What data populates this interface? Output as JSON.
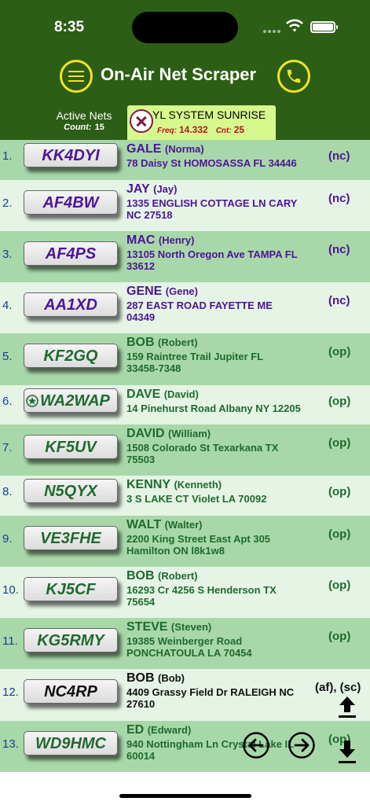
{
  "status_bar": {
    "time": "8:35"
  },
  "header": {
    "title": "On-Air Net Scraper",
    "active_nets_label": "Active Nets",
    "count_label": "Count:",
    "count_value": "15"
  },
  "net_tab": {
    "name": "YL SYSTEM SUNRISE",
    "freq_label": "Freq:",
    "freq_value": "14.332",
    "cnt_label": "Cnt:",
    "cnt_value": "25"
  },
  "colors": {
    "header_green": "#2d5e16",
    "accent_yellow": "#f2e225",
    "row_dark": "#a8d8a9",
    "row_light": "#e5f4e5",
    "nc_purple": "#4d1497",
    "op_green": "#1f6a2f"
  },
  "icons": {
    "menu": "hamburger-icon",
    "phone": "phone-icon",
    "close": "close-icon",
    "prev": "arrow-left-circle-icon",
    "next": "arrow-right-circle-icon",
    "upload": "upload-icon",
    "download": "download-icon",
    "badge": "star-badge-icon"
  },
  "stations": [
    {
      "num": "1.",
      "call": "KK4DYI",
      "name": "GALE",
      "nick": "(Norma)",
      "addr1": "78 Daisy St HOMOSASSA FL 34446",
      "addr2": "",
      "status": "(nc)",
      "kind": "nc"
    },
    {
      "num": "2.",
      "call": "AF4BW",
      "name": "JAY",
      "nick": "(Jay)",
      "addr1": "1335 ENGLISH COTTAGE LN CARY",
      "addr2": "NC 27518",
      "status": "(nc)",
      "kind": "nc"
    },
    {
      "num": "3.",
      "call": "AF4PS",
      "name": "MAC",
      "nick": "(Henry)",
      "addr1": "13105 North Oregon Ave TAMPA FL",
      "addr2": "33612",
      "status": "(nc)",
      "kind": "nc"
    },
    {
      "num": "4.",
      "call": "AA1XD",
      "name": "GENE",
      "nick": "(Gene)",
      "addr1": "287 EAST ROAD FAYETTE ME",
      "addr2": "04349",
      "status": "(nc)",
      "kind": "nc"
    },
    {
      "num": "5.",
      "call": "KF2GQ",
      "name": "BOB",
      "nick": "(Robert)",
      "addr1": "159 Raintree Trail Jupiter FL",
      "addr2": "33458-7348",
      "status": "(op)",
      "kind": "op"
    },
    {
      "num": "6.",
      "call": "WA2WAP",
      "name": "DAVE",
      "nick": "(David)",
      "addr1": "14 Pinehurst Road Albany NY 12205",
      "addr2": "",
      "status": "(op)",
      "kind": "op"
    },
    {
      "num": "7.",
      "call": "KF5UV",
      "name": "DAVID",
      "nick": "(William)",
      "addr1": "1508 Colorado St Texarkana TX",
      "addr2": "75503",
      "status": "(op)",
      "kind": "op"
    },
    {
      "num": "8.",
      "call": "N5QYX",
      "name": "KENNY",
      "nick": "(Kenneth)",
      "addr1": "3 S LAKE CT Violet LA 70092",
      "addr2": "",
      "status": "(op)",
      "kind": "op"
    },
    {
      "num": "9.",
      "call": "VE3FHE",
      "name": "WALT",
      "nick": "(Walter)",
      "addr1": "2200 King Street East  Apt 305",
      "addr2": "Hamilton ON l8k1w8",
      "status": "(op)",
      "kind": "op"
    },
    {
      "num": "10.",
      "call": "KJ5CF",
      "name": "BOB",
      "nick": "(Robert)",
      "addr1": "16293 Cr 4256 S Henderson TX",
      "addr2": "75654",
      "status": "(op)",
      "kind": "op"
    },
    {
      "num": "11.",
      "call": "KG5RMY",
      "name": "STEVE",
      "nick": "(Steven)",
      "addr1": "19385 Weinberger Road",
      "addr2": "PONCHATOULA LA 70454",
      "status": "(op)",
      "kind": "op"
    },
    {
      "num": "12.",
      "call": "NC4RP",
      "name": "BOB",
      "nick": "(Bob)",
      "addr1": "4409 Grassy Field Dr RALEIGH NC",
      "addr2": "27610",
      "status": "(af), (sc)",
      "kind": "af"
    },
    {
      "num": "13.",
      "call": "WD9HMC",
      "name": "ED",
      "nick": "(Edward)",
      "addr1": "940 Nottingham Ln Crystal Lake IL",
      "addr2": "60014",
      "status": "(op)",
      "kind": "op"
    }
  ]
}
